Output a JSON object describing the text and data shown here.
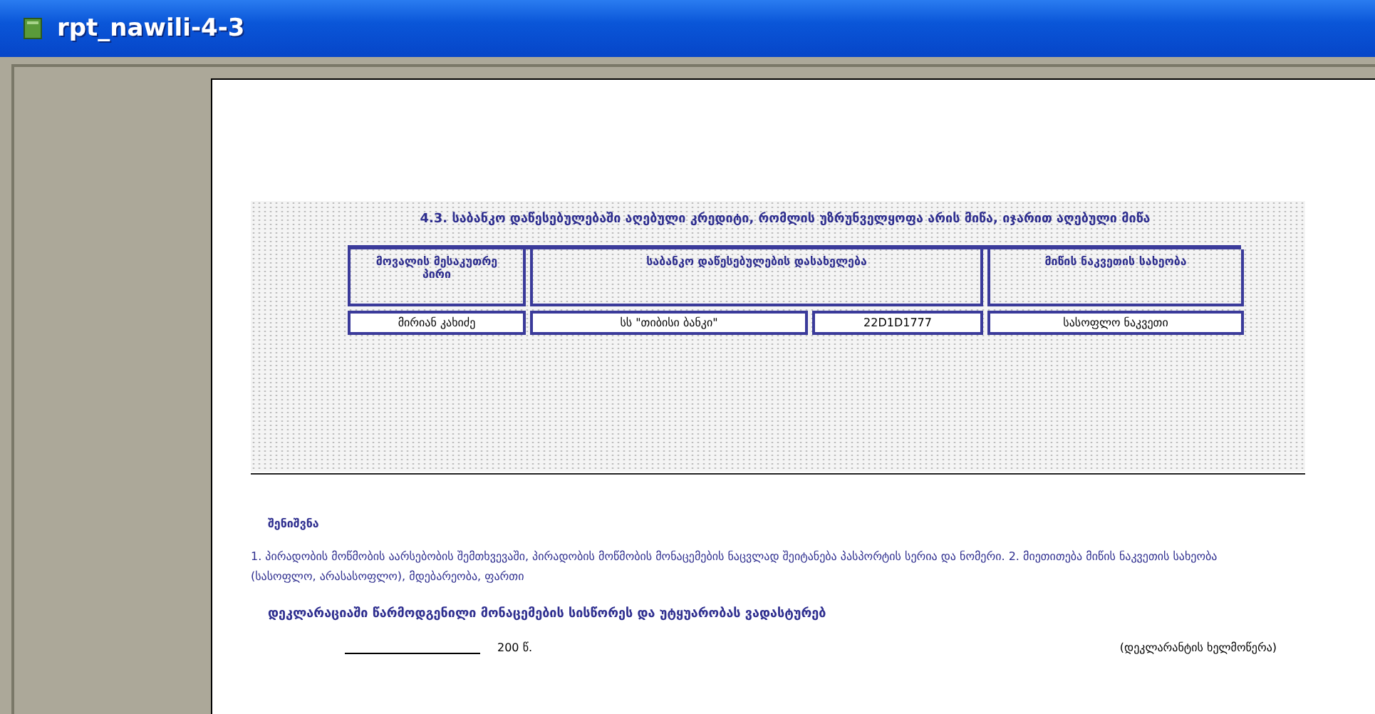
{
  "window": {
    "title": "rpt_nawili-4-3"
  },
  "section": {
    "title": "4.3. საბანკო დაწესებულებაში აღებული კრედიტი, რომლის უზრუნველყოფა არის მიწა, იჯარით აღებული მიწა",
    "columns": [
      "მოვალის მესაკუთრე პირი",
      "საბანკო დაწესებულების დასახელება",
      "",
      "მიწის ნაკვეთის სახეობა"
    ],
    "rows": [
      [
        "მირიან კახიძე",
        "სს \"თიბისი ბანკი\"",
        "22D1D1777",
        "სასოფლო ნაკვეთი"
      ]
    ]
  },
  "note": {
    "heading": "შენიშვნა",
    "text": "1. პირადობის მოწმობის აარსებობის შემთხვევაში, პირადობის მოწმობის მონაცემების ნაცვლად შეიტანება პასპორტის სერია და ნომერი. 2. მიეთითება მიწის ნაკვეთის სახეობა (სასოფლო, არასასოფლო), მდებარეობა, ფართი"
  },
  "confirmation": "დეკლარაციაში წარმოდგენილი მონაცემების სისწორეს და უტყუარობას ვადასტურებ",
  "date_suffix": "200  წ.",
  "signature_label": "(დეკლარანტის ხელმოწერა)"
}
